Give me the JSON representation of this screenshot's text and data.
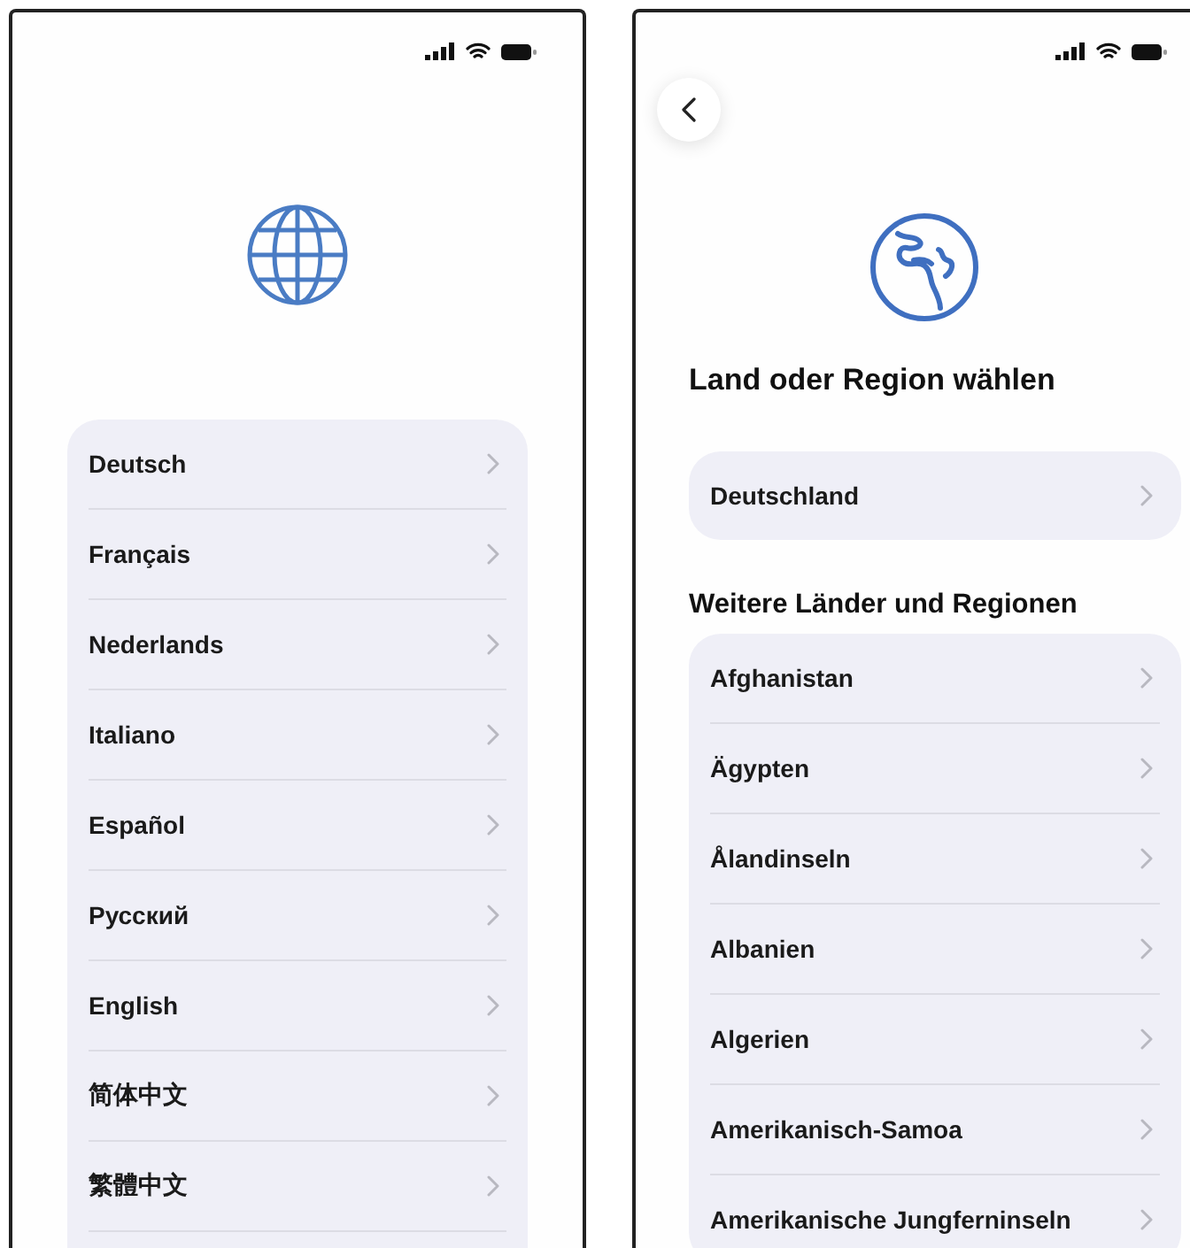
{
  "language_screen": {
    "languages": [
      "Deutsch",
      "Français",
      "Nederlands",
      "Italiano",
      "Español",
      "Русский",
      "English",
      "简体中文",
      "繁體中文"
    ]
  },
  "region_screen": {
    "title": "Land oder Region wählen",
    "suggested": [
      "Deutschland"
    ],
    "section_title": "Weitere Länder und Regionen",
    "regions": [
      "Afghanistan",
      "Ägypten",
      "Ålandinseln",
      "Albanien",
      "Algerien",
      "Amerikanisch-Samoa",
      "Amerikanische Jungferninseln"
    ]
  }
}
